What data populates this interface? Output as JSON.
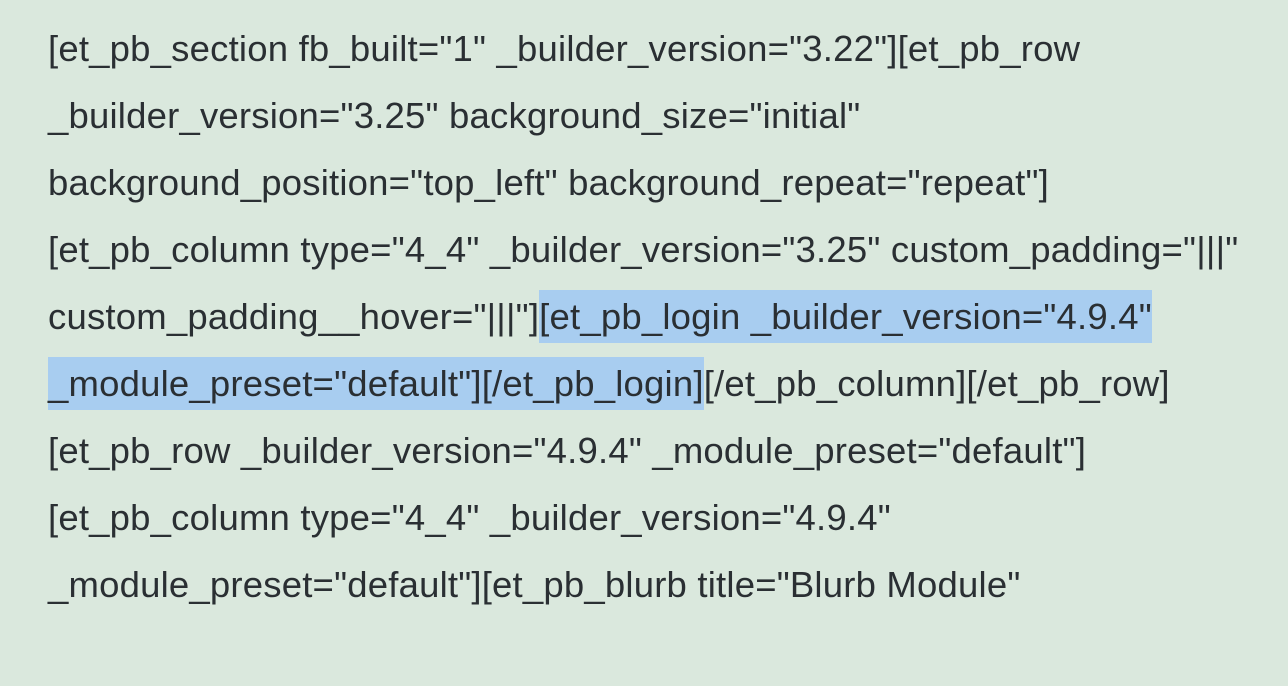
{
  "code": {
    "part1": "[et_pb_section fb_built=\"1\" _builder_version=\"3.22\"][et_pb_row _builder_version=\"3.25\" background_size=\"initial\" background_position=\"top_left\" background_repeat=\"repeat\"][et_pb_column type=\"4_4\" _builder_version=\"3.25\" custom_padding=\"|||\" custom_padding__hover=\"|||\"]",
    "highlighted": "[et_pb_login _builder_version=\"4.9.4\" _module_preset=\"default\"][/et_pb_login]",
    "part2": "[/et_pb_column][/et_pb_row][et_pb_row _builder_version=\"4.9.4\" _module_preset=\"default\"][et_pb_column type=\"4_4\" _builder_version=\"4.9.4\" _module_preset=\"default\"][et_pb_blurb title=\"Blurb Module\""
  }
}
